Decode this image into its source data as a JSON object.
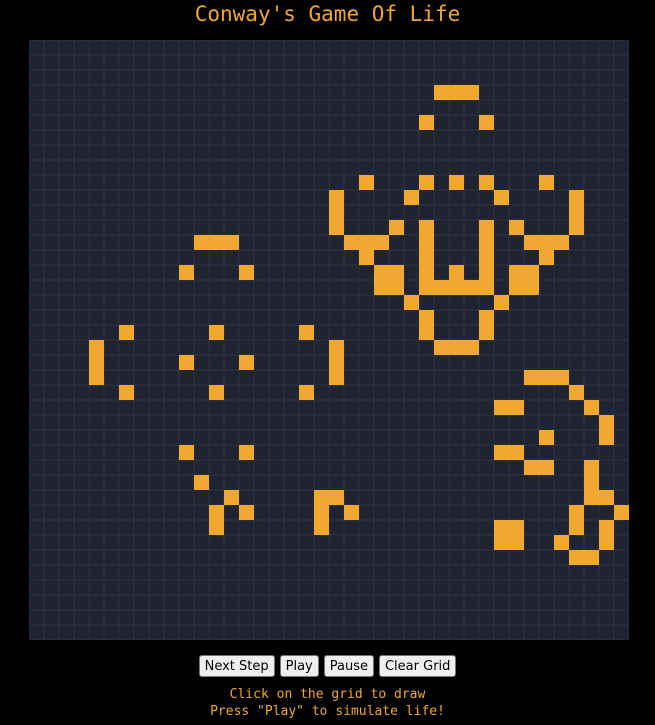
{
  "title": "Conway's Game Of Life",
  "grid": {
    "rows": 40,
    "cols": 40,
    "colors": {
      "background": "#1f2430",
      "lines": "#2e3542",
      "alive": "#f0a830"
    },
    "alive_cells": [
      [
        3,
        27
      ],
      [
        3,
        28
      ],
      [
        3,
        29
      ],
      [
        5,
        26
      ],
      [
        5,
        30
      ],
      [
        9,
        22
      ],
      [
        9,
        26
      ],
      [
        9,
        28
      ],
      [
        9,
        30
      ],
      [
        9,
        34
      ],
      [
        10,
        20
      ],
      [
        10,
        25
      ],
      [
        10,
        31
      ],
      [
        10,
        36
      ],
      [
        11,
        20
      ],
      [
        11,
        36
      ],
      [
        12,
        20
      ],
      [
        12,
        24
      ],
      [
        12,
        26
      ],
      [
        12,
        30
      ],
      [
        12,
        32
      ],
      [
        12,
        36
      ],
      [
        13,
        11
      ],
      [
        13,
        12
      ],
      [
        13,
        13
      ],
      [
        13,
        21
      ],
      [
        13,
        22
      ],
      [
        13,
        23
      ],
      [
        13,
        26
      ],
      [
        13,
        30
      ],
      [
        13,
        33
      ],
      [
        13,
        34
      ],
      [
        13,
        35
      ],
      [
        14,
        22
      ],
      [
        14,
        26
      ],
      [
        14,
        30
      ],
      [
        14,
        34
      ],
      [
        15,
        10
      ],
      [
        15,
        14
      ],
      [
        15,
        23
      ],
      [
        15,
        24
      ],
      [
        15,
        26
      ],
      [
        15,
        28
      ],
      [
        15,
        30
      ],
      [
        15,
        32
      ],
      [
        15,
        33
      ],
      [
        16,
        23
      ],
      [
        16,
        24
      ],
      [
        16,
        26
      ],
      [
        16,
        27
      ],
      [
        16,
        28
      ],
      [
        16,
        29
      ],
      [
        16,
        30
      ],
      [
        16,
        32
      ],
      [
        16,
        33
      ],
      [
        17,
        25
      ],
      [
        17,
        31
      ],
      [
        18,
        26
      ],
      [
        18,
        30
      ],
      [
        19,
        6
      ],
      [
        19,
        12
      ],
      [
        19,
        18
      ],
      [
        19,
        26
      ],
      [
        19,
        30
      ],
      [
        20,
        4
      ],
      [
        20,
        20
      ],
      [
        20,
        27
      ],
      [
        20,
        28
      ],
      [
        20,
        29
      ],
      [
        21,
        4
      ],
      [
        21,
        10
      ],
      [
        21,
        14
      ],
      [
        21,
        20
      ],
      [
        22,
        4
      ],
      [
        22,
        20
      ],
      [
        22,
        33
      ],
      [
        22,
        34
      ],
      [
        22,
        35
      ],
      [
        23,
        6
      ],
      [
        23,
        12
      ],
      [
        23,
        18
      ],
      [
        23,
        36
      ],
      [
        24,
        31
      ],
      [
        24,
        32
      ],
      [
        24,
        37
      ],
      [
        25,
        38
      ],
      [
        26,
        34
      ],
      [
        26,
        38
      ],
      [
        27,
        10
      ],
      [
        27,
        14
      ],
      [
        27,
        31
      ],
      [
        27,
        32
      ],
      [
        28,
        33
      ],
      [
        28,
        34
      ],
      [
        28,
        37
      ],
      [
        29,
        11
      ],
      [
        29,
        37
      ],
      [
        30,
        13
      ],
      [
        30,
        19
      ],
      [
        30,
        20
      ],
      [
        30,
        37
      ],
      [
        30,
        38
      ],
      [
        31,
        12
      ],
      [
        31,
        14
      ],
      [
        31,
        19
      ],
      [
        31,
        21
      ],
      [
        31,
        36
      ],
      [
        31,
        39
      ],
      [
        32,
        12
      ],
      [
        32,
        19
      ],
      [
        32,
        31
      ],
      [
        32,
        32
      ],
      [
        32,
        36
      ],
      [
        32,
        38
      ],
      [
        33,
        31
      ],
      [
        33,
        32
      ],
      [
        33,
        35
      ],
      [
        33,
        38
      ],
      [
        34,
        36
      ],
      [
        34,
        37
      ]
    ]
  },
  "controls": {
    "next_step": "Next Step",
    "play": "Play",
    "pause": "Pause",
    "clear": "Clear Grid"
  },
  "instructions": {
    "line1": "Click on the grid to draw",
    "line2": "Press \"Play\" to simulate life!"
  }
}
